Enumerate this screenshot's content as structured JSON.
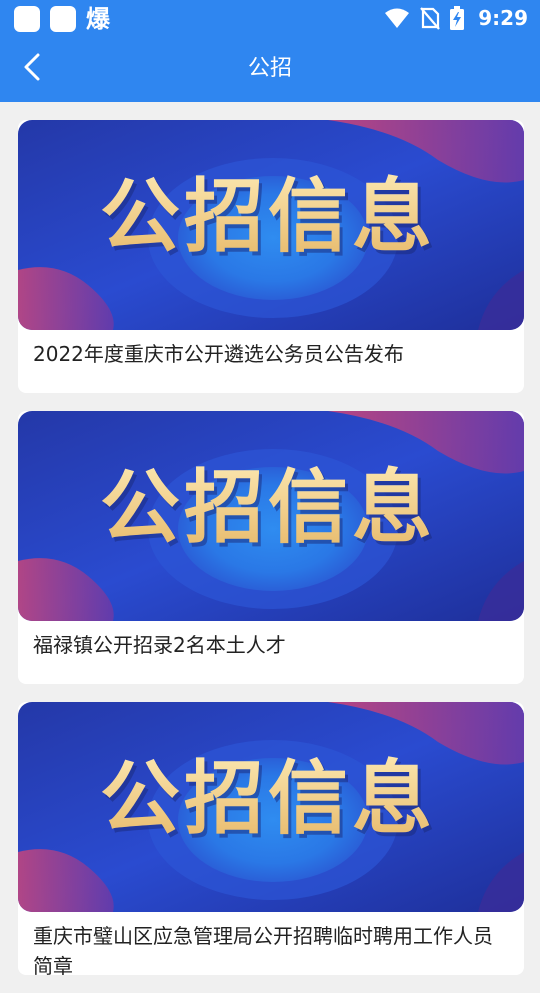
{
  "status_bar": {
    "notification_char": "爆",
    "time": "9:29",
    "icons": [
      "app-icon",
      "app-icon",
      "wifi-icon",
      "no-sim-icon",
      "battery-charging-icon"
    ]
  },
  "navbar": {
    "back_icon": "chevron-left-icon",
    "title": "公招"
  },
  "banner_text": "公招信息",
  "colors": {
    "header": "#2f86f0",
    "banner_blue": "#2a49c8",
    "banner_gold": "#f3d48a",
    "card_bg": "#ffffff",
    "page_bg": "#f0f0f0"
  },
  "articles": [
    {
      "title": "2022年度重庆市公开遴选公务员公告发布"
    },
    {
      "title": "福禄镇公开招录2名本土人才"
    },
    {
      "title": "重庆市璧山区应急管理局公开招聘临时聘用工作人员简章"
    }
  ]
}
